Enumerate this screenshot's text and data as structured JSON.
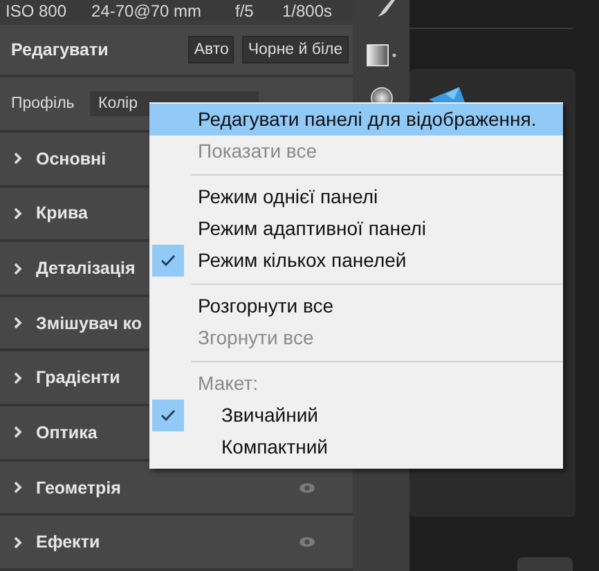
{
  "exif": [
    "ISO 800",
    "24-70@70 mm",
    "f/5",
    "1/800s"
  ],
  "edit": {
    "title": "Редагувати",
    "buttons": [
      "Авто",
      "Чорне й біле"
    ]
  },
  "profile": {
    "label": "Профіль",
    "value": "Колір"
  },
  "sections": [
    {
      "label": "Основні"
    },
    {
      "label": "Крива"
    },
    {
      "label": "Деталізація"
    },
    {
      "label": "Змішувач ко"
    },
    {
      "label": "Градієнти"
    },
    {
      "label": "Оптика"
    },
    {
      "label": "Геометрія",
      "eye": true
    },
    {
      "label": "Ефекти",
      "eye": true
    }
  ],
  "context_menu": [
    {
      "kind": "item",
      "label": "Редагувати панелі для відображення.",
      "selected": true,
      "disabled": false,
      "checked": false
    },
    {
      "kind": "item",
      "label": "Показати все",
      "selected": false,
      "disabled": true,
      "checked": false
    },
    {
      "kind": "separator"
    },
    {
      "kind": "item",
      "label": "Режим однієї панелі",
      "selected": false,
      "disabled": false,
      "checked": false
    },
    {
      "kind": "item",
      "label": "Режим адаптивної панелі",
      "selected": false,
      "disabled": false,
      "checked": false
    },
    {
      "kind": "item",
      "label": "Режим кількох панелей",
      "selected": false,
      "disabled": false,
      "checked": true
    },
    {
      "kind": "separator"
    },
    {
      "kind": "item",
      "label": "Розгорнути все",
      "selected": false,
      "disabled": false,
      "checked": false
    },
    {
      "kind": "item",
      "label": "Згорнути все",
      "selected": false,
      "disabled": true,
      "checked": false
    },
    {
      "kind": "separator"
    },
    {
      "kind": "header",
      "label": "Макет:",
      "children": [
        {
          "kind": "item",
          "label": "Звичайний",
          "selected": false,
          "disabled": false,
          "checked": true
        },
        {
          "kind": "item",
          "label": "Компактний",
          "selected": false,
          "disabled": false,
          "checked": false
        }
      ]
    }
  ]
}
